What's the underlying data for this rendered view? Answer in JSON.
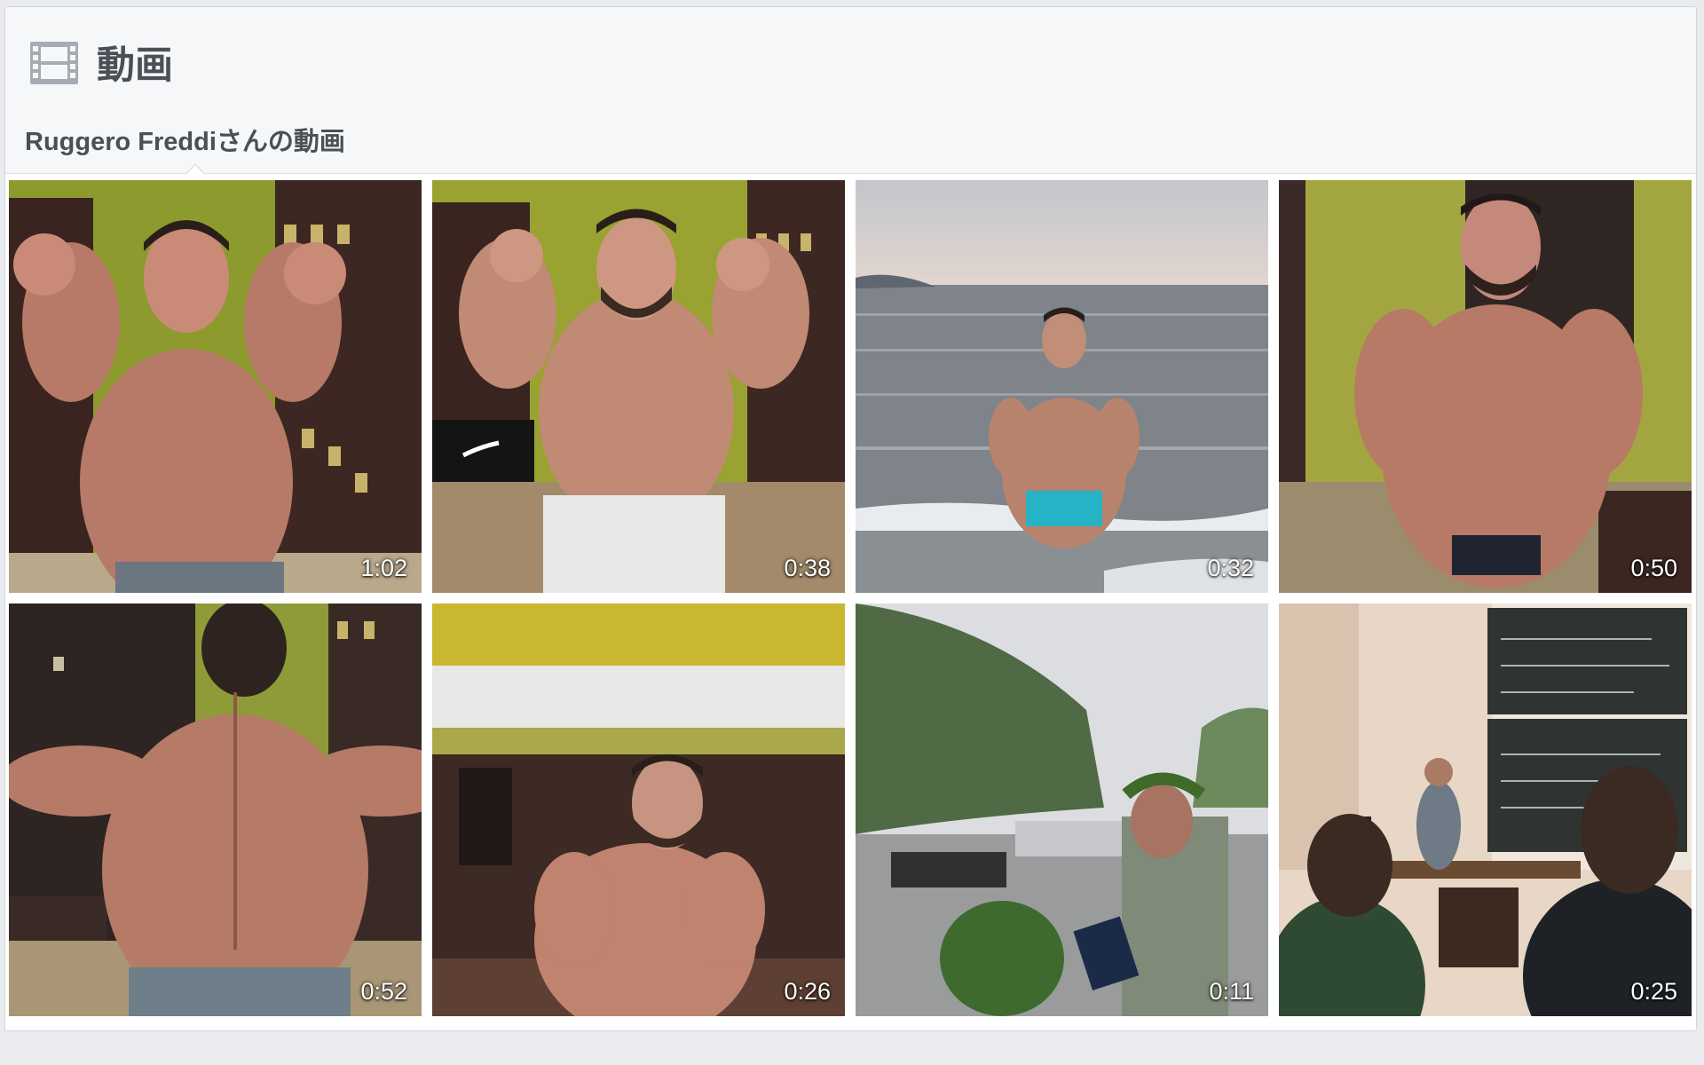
{
  "header": {
    "title": "動画",
    "icon": "film-strip-icon"
  },
  "subtab": {
    "label": "Ruggero Freddiさんの動画"
  },
  "videos": [
    {
      "duration": "1:02",
      "scene": "locker-room-front-double-biceps"
    },
    {
      "duration": "0:38",
      "scene": "locker-room-front-double-biceps-white-pants"
    },
    {
      "duration": "0:32",
      "scene": "beach-sea-pose"
    },
    {
      "duration": "0:50",
      "scene": "locker-room-most-muscular"
    },
    {
      "duration": "0:52",
      "scene": "locker-room-back-pose"
    },
    {
      "duration": "0:26",
      "scene": "locker-room-chest-pose"
    },
    {
      "duration": "0:11",
      "scene": "outdoor-graduation-laurel"
    },
    {
      "duration": "0:25",
      "scene": "classroom-blackboard-lecture"
    }
  ],
  "colors": {
    "page_bg": "#e9ebee",
    "header_bg": "#f6f7f9",
    "title_text": "#4b4f56",
    "duration_text": "#ffffff"
  }
}
